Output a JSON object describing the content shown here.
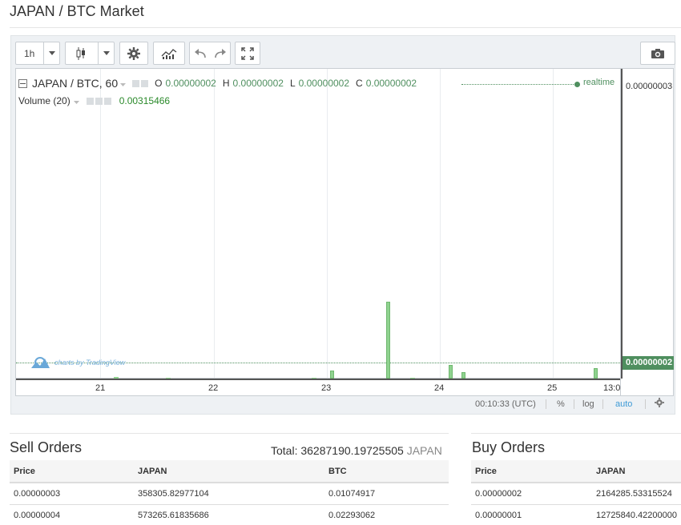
{
  "page": {
    "title": "JAPAN / BTC Market"
  },
  "toolbar": {
    "interval": "1h",
    "icons": [
      "chevron-down-icon",
      "candles-icon",
      "chevron-down-icon",
      "gear-icon",
      "indicators-icon",
      "undo-icon",
      "redo-icon",
      "fullscreen-icon",
      "camera-icon"
    ]
  },
  "legend": {
    "symbol": "JAPAN / BTC, 60",
    "o_label": "O",
    "o_value": "0.00000002",
    "h_label": "H",
    "h_value": "0.00000002",
    "l_label": "L",
    "l_value": "0.00000002",
    "c_label": "C",
    "c_value": "0.00000002",
    "volume_label": "Volume (20)",
    "volume_value": "0.00315466",
    "realtime": "realtime",
    "watermark": "charts by TradingView"
  },
  "price_axis": {
    "top_label": "0.00000003",
    "last_price": "0.00000002"
  },
  "time_axis": {
    "labels": [
      "21",
      "22",
      "23",
      "24",
      "25",
      "13:0"
    ]
  },
  "status": {
    "clock": "00:10:33 (UTC)",
    "percent": "%",
    "log": "log",
    "auto": "auto"
  },
  "chart_data": {
    "type": "bar",
    "series": [
      {
        "values": [
          2e-05,
          1e-05,
          1e-05,
          0.00025,
          0.0024,
          1e-05,
          0.00045,
          0.0002,
          0.00036
        ]
      }
    ],
    "volume_marks": [
      0.02,
      0.01,
      0.01,
      0.1,
      1.0,
      0.01,
      0.18,
      0.08,
      0.14
    ]
  },
  "colors": {
    "accent": "#4f8f5f",
    "volume": "#8fd28f"
  },
  "sell_orders": {
    "title": "Sell Orders",
    "total_label": "Total: 36287190.19725505",
    "total_unit": "JAPAN",
    "columns": [
      "Price",
      "JAPAN",
      "BTC"
    ],
    "rows": [
      [
        "0.00000003",
        "358305.82977104",
        "0.01074917"
      ],
      [
        "0.00000004",
        "573265.61835686",
        "0.02293062"
      ]
    ]
  },
  "buy_orders": {
    "title": "Buy Orders",
    "columns": [
      "Price",
      "JAPAN"
    ],
    "rows": [
      [
        "0.00000002",
        "2164285.53315524"
      ],
      [
        "0.00000001",
        "12725840.42200000"
      ]
    ]
  }
}
